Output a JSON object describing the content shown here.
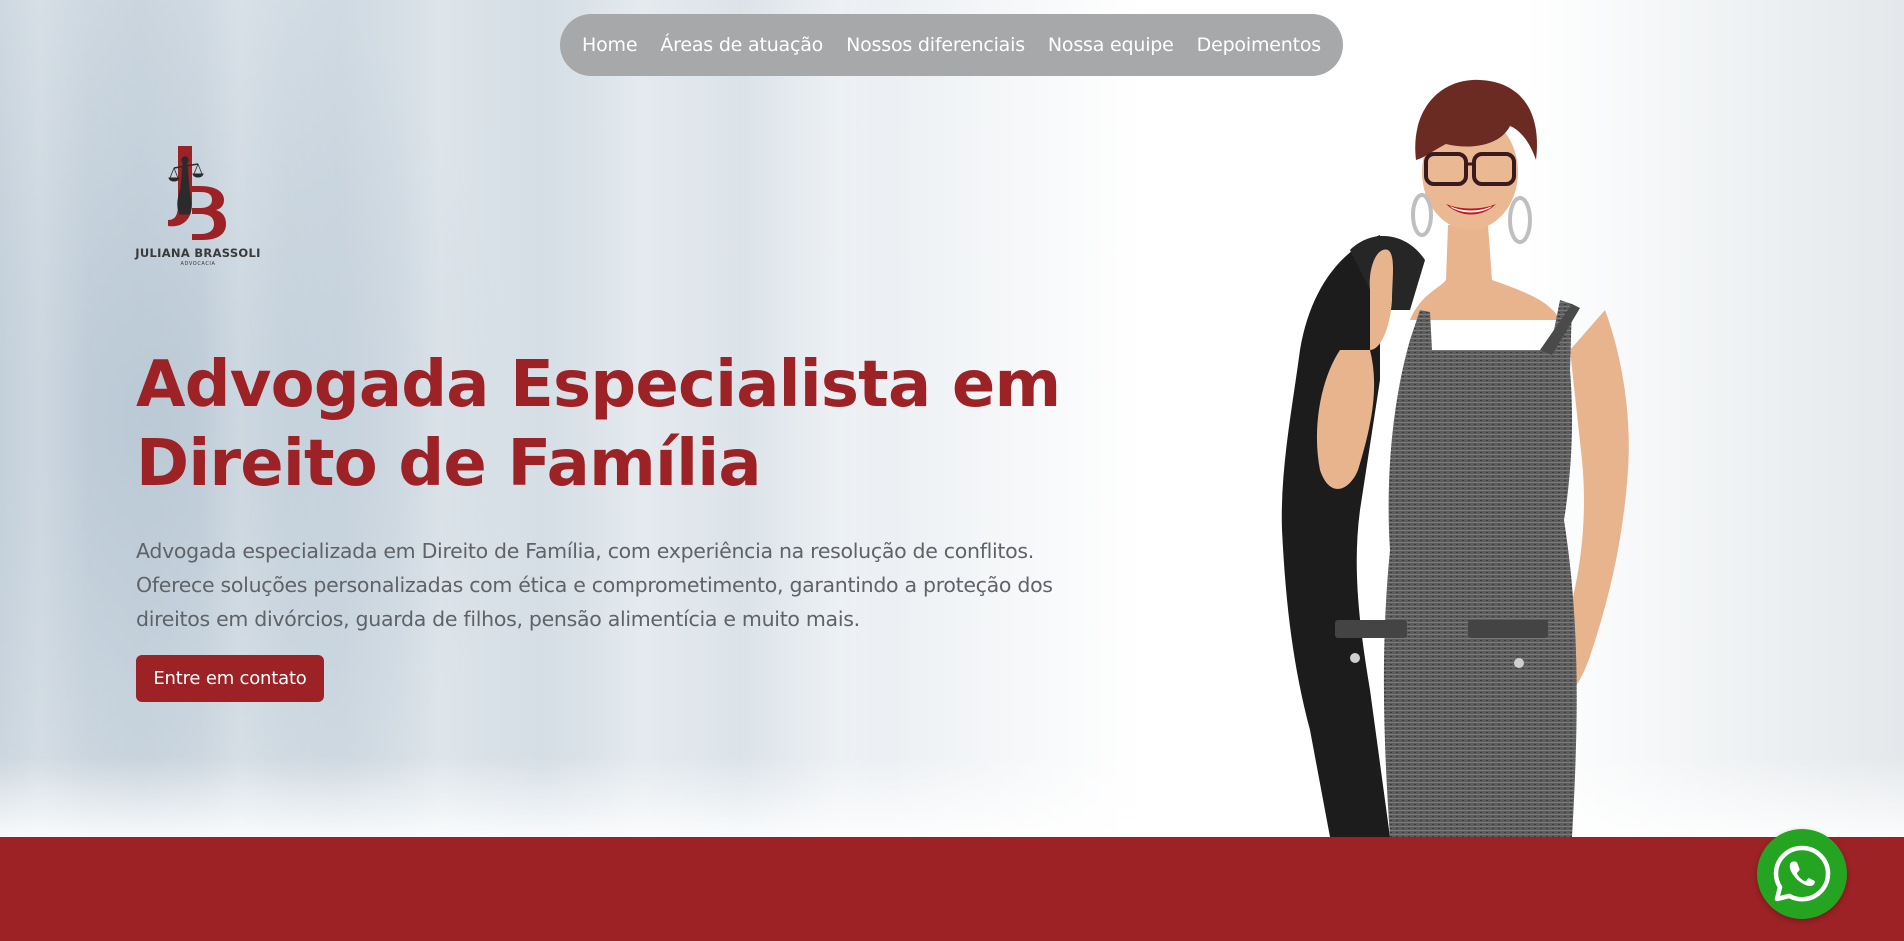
{
  "nav": {
    "items": [
      {
        "label": "Home"
      },
      {
        "label": "Áreas de atuação"
      },
      {
        "label": "Nossos diferenciais"
      },
      {
        "label": "Nossa equipe"
      },
      {
        "label": "Depoimentos"
      }
    ]
  },
  "logo": {
    "name": "JULIANA BRASSOLI",
    "subtitle": "ADVOCACIA",
    "monogram": "JB",
    "icon": "scales-of-justice-icon"
  },
  "hero": {
    "headline_line1": "Advogada Especialista em",
    "headline_line2": "Direito de Família",
    "description_line1": "Advogada especializada em Direito de Família, com experiência na resolução de conflitos.",
    "description_line2": "Oferece soluções personalizadas com ética e comprometimento, garantindo a proteção dos",
    "description_line3": "direitos em divórcios, guarda de filhos, pensão alimentícia e muito mais.",
    "cta_label": "Entre em contato",
    "portrait": "portrait-photo"
  },
  "floating": {
    "whatsapp_icon": "whatsapp-icon"
  },
  "colors": {
    "brand": "#9c2226",
    "nav_pill": "#a6a8a9",
    "whatsapp": "#25a422",
    "body_text": "#5f6368"
  }
}
